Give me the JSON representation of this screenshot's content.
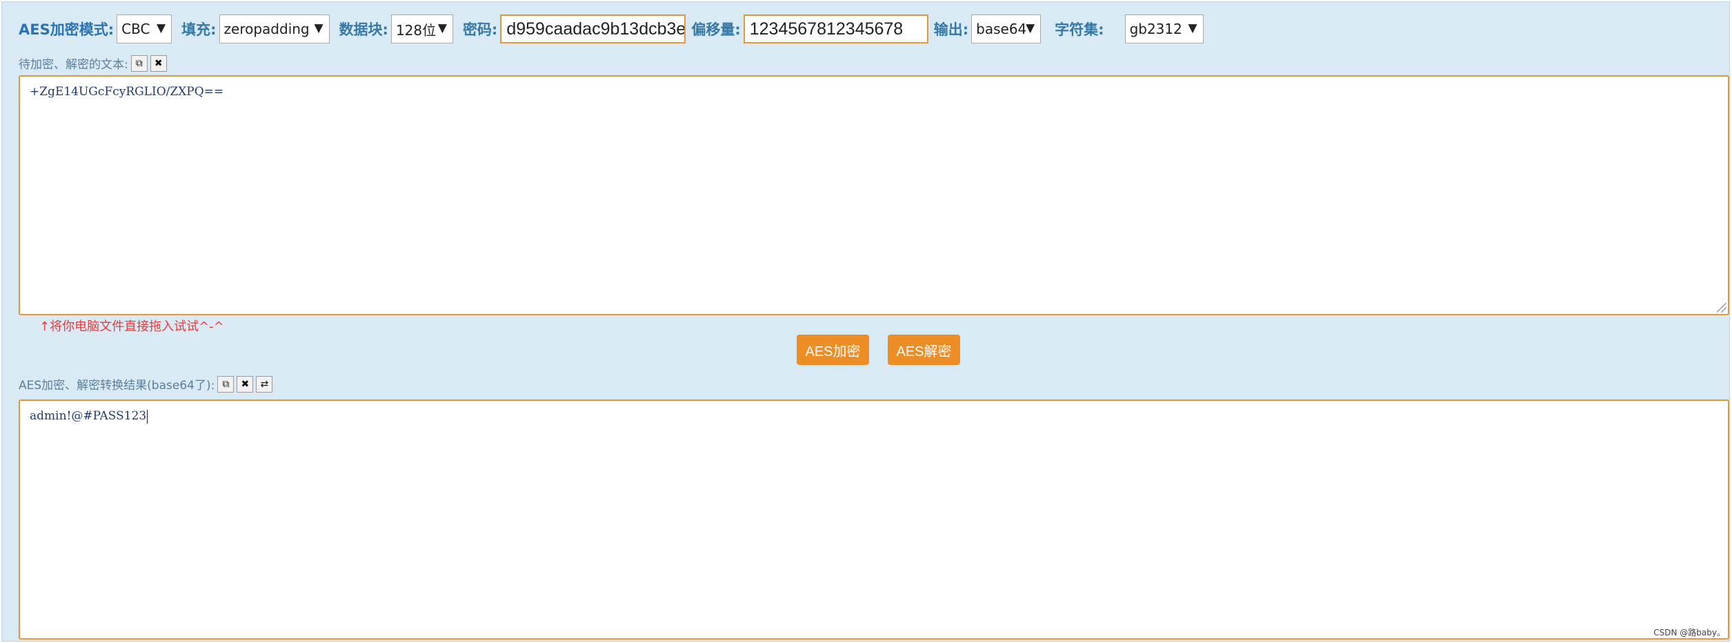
{
  "toolbar": {
    "mode_label": "AES加密模式:",
    "mode_value": "CBC",
    "padding_label": "填充:",
    "padding_value": "zeropadding",
    "block_label": "数据块:",
    "block_value": "128位",
    "password_label": "密码:",
    "password_value": "d959caadac9b13dcb3e",
    "iv_label": "偏移量:",
    "iv_value": "1234567812345678",
    "output_label": "输出:",
    "output_value": "base64",
    "charset_label": "字符集:",
    "charset_value": "gb2312"
  },
  "input_section": {
    "caption": "待加密、解密的文本:",
    "text": "+ZgE14UGcFcyRGLIO/ZXPQ==",
    "hint": "↑将你电脑文件直接拖入试试^-^"
  },
  "actions": {
    "encrypt_label": "AES加密",
    "decrypt_label": "AES解密"
  },
  "output_section": {
    "caption": "AES加密、解密转换结果(base64了):",
    "text": "admin!@#PASS123"
  },
  "watermark": "CSDN @路baby。",
  "icons": {
    "copy": "copy-icon",
    "clear": "close-icon",
    "swap": "swap-icon"
  },
  "colors": {
    "background": "#d9eaf4",
    "accent": "#ec8d26",
    "label": "#3579a8",
    "hint": "#e83b3b"
  }
}
